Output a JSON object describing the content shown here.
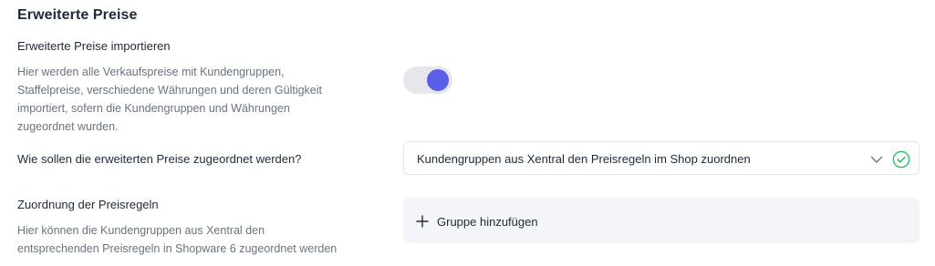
{
  "section": {
    "title": "Erweiterte Preise"
  },
  "import_setting": {
    "label": "Erweiterte Preise importieren",
    "description_lines": [
      "Hier werden alle Verkaufspreise mit Kundengruppen,",
      "Staffelpreise, verschiedene Währungen und deren Gültigkeit",
      "importiert, sofern die Kundengruppen und Währungen",
      "zugeordnet wurden."
    ],
    "toggle_on": true,
    "toggle_color": "#5b5fe8"
  },
  "assignment_setting": {
    "label": "Wie sollen die erweiterten Preise zugeordnet werden?",
    "selected_value": "Kundengruppen aus Xentral den Preisregeln im Shop zuordnen",
    "valid_icon": "check-circle-icon",
    "valid_color": "#22c55e"
  },
  "price_rules": {
    "label": "Zuordnung der Preisregeln",
    "description_lines": [
      "Hier können die Kundengruppen aus Xentral den",
      "entsprechenden Preisregeln in Shopware 6 zugeordnet werden"
    ],
    "add_button_label": "Gruppe hinzufügen",
    "add_icon": "plus-icon"
  }
}
